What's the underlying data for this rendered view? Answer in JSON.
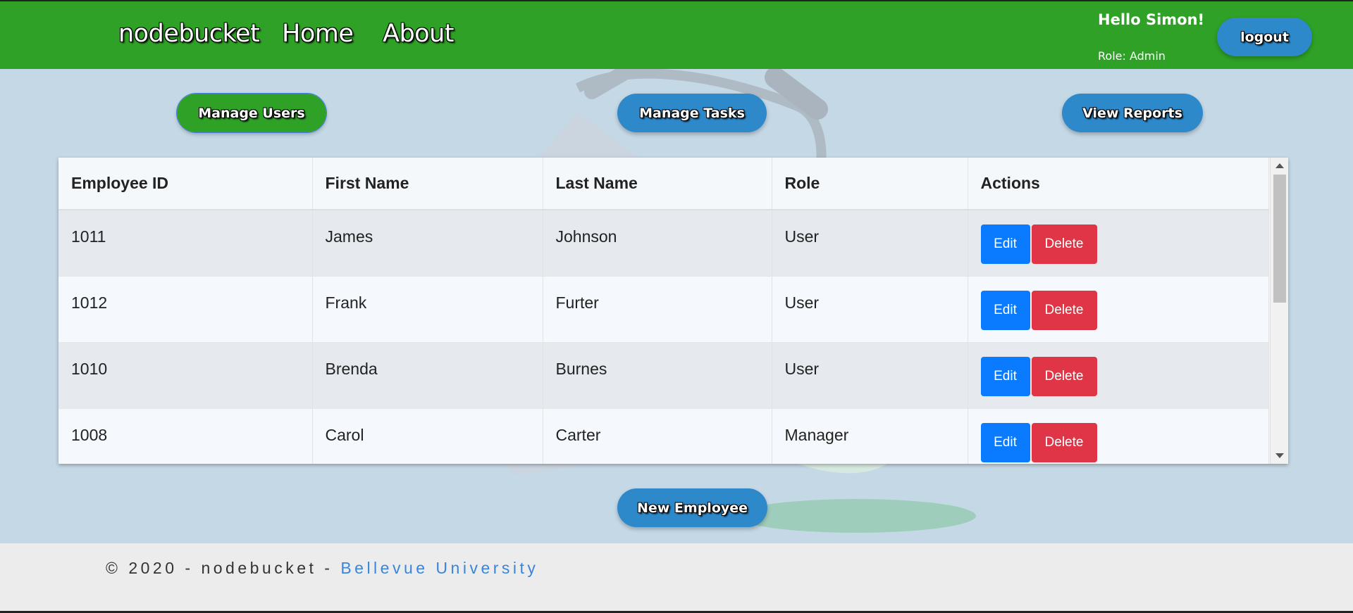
{
  "nav": {
    "brand": "nodebucket",
    "links": [
      "Home",
      "About"
    ],
    "greeting": "Hello Simon!",
    "role": "Role: Admin",
    "logout": "logout"
  },
  "admin_buttons": {
    "manage_users": "Manage Users",
    "manage_tasks": "Manage Tasks",
    "view_reports": "View Reports"
  },
  "table": {
    "headers": [
      "Employee ID",
      "First Name",
      "Last Name",
      "Role",
      "Actions"
    ],
    "rows": [
      {
        "id": "1011",
        "first": "James",
        "last": "Johnson",
        "role": "User"
      },
      {
        "id": "1012",
        "first": "Frank",
        "last": "Furter",
        "role": "User"
      },
      {
        "id": "1010",
        "first": "Brenda",
        "last": "Burnes",
        "role": "User"
      },
      {
        "id": "1008",
        "first": "Carol",
        "last": "Carter",
        "role": "Manager"
      }
    ],
    "edit_label": "Edit",
    "delete_label": "Delete"
  },
  "new_employee": "New Employee",
  "footer": {
    "prefix": "© 2020 - nodebucket - ",
    "link": "Bellevue University"
  },
  "colors": {
    "navbar": "#2ea126",
    "pill": "#2d89c9",
    "edit": "#0a7bff",
    "delete": "#df3547",
    "link": "#3a85dc"
  }
}
